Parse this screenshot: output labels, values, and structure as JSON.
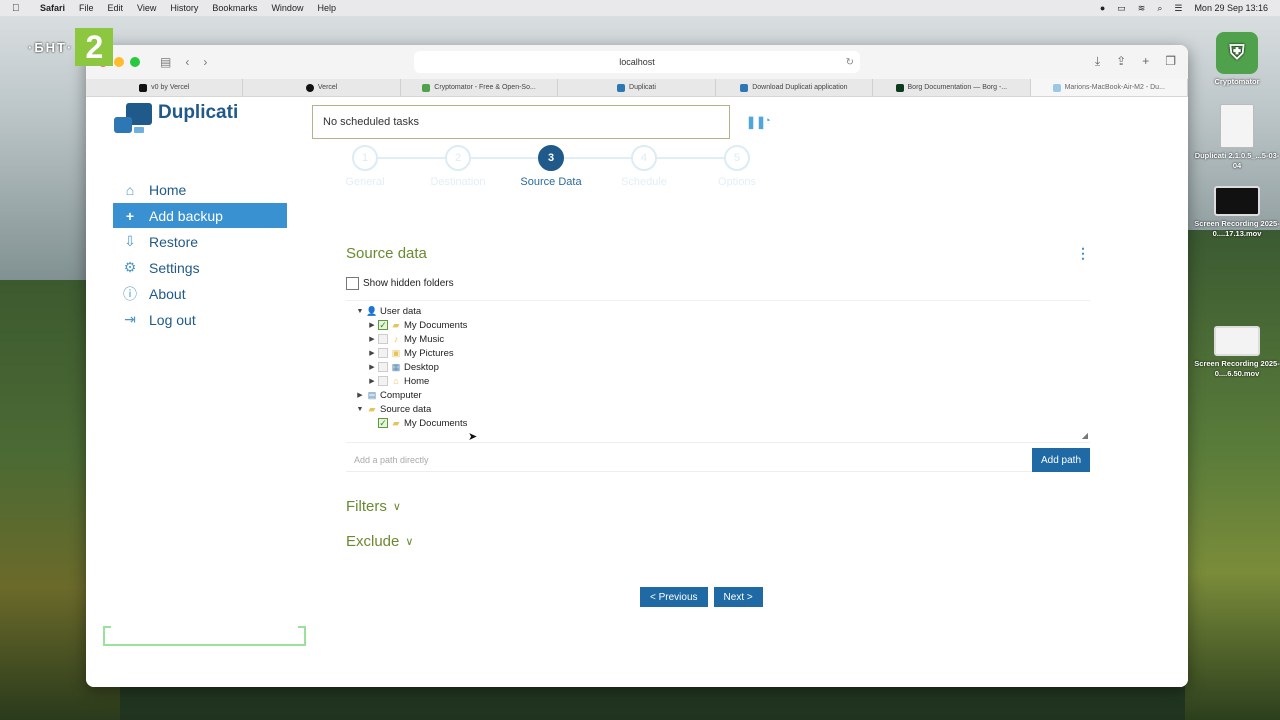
{
  "menubar": {
    "app": "Safari",
    "items": [
      "File",
      "Edit",
      "View",
      "History",
      "Bookmarks",
      "Window",
      "Help"
    ],
    "clock": "Mon 29 Sep  13:16"
  },
  "overlay": {
    "channel_text": "·БНТ·",
    "channel_number": "2"
  },
  "desktop": {
    "icons": [
      {
        "label": "Cryptomator"
      },
      {
        "label": "Duplicati 2.1.0.5_...5-03-04"
      },
      {
        "label": "Screen Recording 2025-0....17.13.mov"
      },
      {
        "label": "Screen Recording 2025-0....6.50.mov"
      }
    ]
  },
  "browser": {
    "url": "localhost",
    "tabs": [
      {
        "label": "v0 by Vercel"
      },
      {
        "label": "Vercel"
      },
      {
        "label": "Cryptomator - Free & Open-So..."
      },
      {
        "label": "Duplicati"
      },
      {
        "label": "Download Duplicati application"
      },
      {
        "label": "Borg Documentation — Borg -..."
      },
      {
        "label": "Marions-MacBook-Air-M2 - Du..."
      }
    ]
  },
  "app": {
    "brand": "Duplicati",
    "status": "No scheduled tasks",
    "sidebar": [
      {
        "label": "Home",
        "icon": "home-icon"
      },
      {
        "label": "Add backup",
        "icon": "plus-icon",
        "active": true
      },
      {
        "label": "Restore",
        "icon": "download-icon"
      },
      {
        "label": "Settings",
        "icon": "gear-icon"
      },
      {
        "label": "About",
        "icon": "info-icon"
      },
      {
        "label": "Log out",
        "icon": "logout-icon"
      }
    ],
    "wizard": {
      "steps": [
        {
          "num": "1",
          "label": "General"
        },
        {
          "num": "2",
          "label": "Destination"
        },
        {
          "num": "3",
          "label": "Source Data",
          "active": true
        },
        {
          "num": "4",
          "label": "Schedule"
        },
        {
          "num": "5",
          "label": "Options"
        }
      ]
    },
    "source": {
      "title": "Source data",
      "show_hidden": "Show hidden folders",
      "tree": [
        {
          "label": "User data",
          "level": 0,
          "expanded": true
        },
        {
          "label": "My Documents",
          "level": 1,
          "checked": true
        },
        {
          "label": "My Music",
          "level": 1
        },
        {
          "label": "My Pictures",
          "level": 1
        },
        {
          "label": "Desktop",
          "level": 1
        },
        {
          "label": "Home",
          "level": 1
        },
        {
          "label": "Computer",
          "level": 0
        },
        {
          "label": "Source data",
          "level": 0,
          "expanded": true
        },
        {
          "label": "My Documents",
          "level": 1,
          "checked": true
        }
      ],
      "path_placeholder": "Add a path directly",
      "add_path": "Add path"
    },
    "filters": "Filters",
    "exclude": "Exclude",
    "prev": "< Previous",
    "next": "Next >"
  },
  "colors": {
    "accent": "#1f5a8a",
    "active_nav": "#3a91d1",
    "section": "#6a8a30",
    "button": "#1f6aa5"
  }
}
